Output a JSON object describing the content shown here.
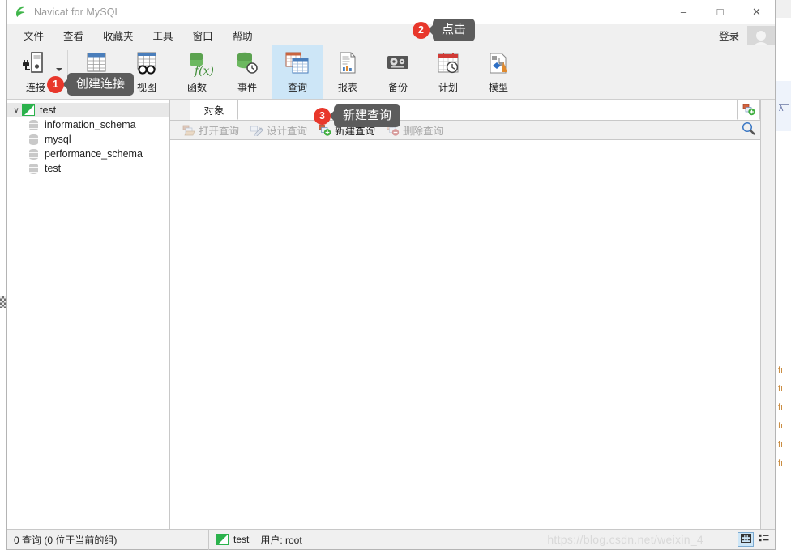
{
  "window": {
    "title": "Navicat for MySQL",
    "logo_icon": "navicat-logo-icon",
    "minimize_label": "–",
    "maximize_label": "□",
    "close_label": "✕"
  },
  "menubar": {
    "items": [
      {
        "label": "文件",
        "name": "menu-file"
      },
      {
        "label": "查看",
        "name": "menu-view"
      },
      {
        "label": "收藏夹",
        "name": "menu-favorites"
      },
      {
        "label": "工具",
        "name": "menu-tools"
      },
      {
        "label": "窗口",
        "name": "menu-window"
      },
      {
        "label": "帮助",
        "name": "menu-help"
      }
    ],
    "login_label": "登录",
    "avatar_icon": "user-avatar-icon"
  },
  "toolbar": {
    "items": [
      {
        "label": "连接",
        "icon": "connection-icon",
        "active": false,
        "has_caret": true
      },
      {
        "label": "表",
        "icon": "table-icon",
        "active": false,
        "has_caret": false
      },
      {
        "label": "视图",
        "icon": "view-icon",
        "active": false,
        "has_caret": false
      },
      {
        "label": "函数",
        "icon": "function-icon",
        "active": false,
        "has_caret": false
      },
      {
        "label": "事件",
        "icon": "event-icon",
        "active": false,
        "has_caret": false
      },
      {
        "label": "查询",
        "icon": "query-icon",
        "active": true,
        "has_caret": false
      },
      {
        "label": "报表",
        "icon": "report-icon",
        "active": false,
        "has_caret": false
      },
      {
        "label": "备份",
        "icon": "backup-icon",
        "active": false,
        "has_caret": false
      },
      {
        "label": "计划",
        "icon": "schedule-icon",
        "active": false,
        "has_caret": false
      },
      {
        "label": "模型",
        "icon": "model-icon",
        "active": false,
        "has_caret": false
      }
    ]
  },
  "sidebar": {
    "root": {
      "label": "test",
      "icon": "connection-node-icon",
      "expanded": true,
      "twisty": "∨"
    },
    "databases": [
      {
        "label": "information_schema",
        "icon": "database-icon"
      },
      {
        "label": "mysql",
        "icon": "database-icon"
      },
      {
        "label": "performance_schema",
        "icon": "database-icon"
      },
      {
        "label": "test",
        "icon": "database-icon"
      }
    ]
  },
  "main": {
    "tab_label": "对象",
    "add_tab_icon": "new-object-tab-icon",
    "actions": [
      {
        "label": "打开查询",
        "icon": "open-query-icon",
        "enabled": false
      },
      {
        "label": "设计查询",
        "icon": "design-query-icon",
        "enabled": false
      },
      {
        "label": "新建查询",
        "icon": "new-query-icon",
        "enabled": true
      },
      {
        "label": "删除查询",
        "icon": "delete-query-icon",
        "enabled": false
      }
    ],
    "search_icon": "search-icon"
  },
  "statusbar": {
    "count_text": "0 查询 (0 位于当前的组)",
    "connection_icon": "connection-node-icon",
    "connection_name": "test",
    "user_text": "用户: root",
    "watermark": "https://blog.csdn.net/weixin_4",
    "view_buttons": [
      {
        "name": "grid-view-button",
        "icon": "grid-view-icon",
        "selected": true
      },
      {
        "name": "list-view-button",
        "icon": "list-view-icon",
        "selected": false
      }
    ]
  },
  "callouts": [
    {
      "number": "1",
      "text": "创建连接",
      "id": "callout-1"
    },
    {
      "number": "2",
      "text": "点击",
      "id": "callout-2"
    },
    {
      "number": "3",
      "text": "新建查询",
      "id": "callout-3"
    }
  ],
  "background": {
    "right_text_lines": [
      "fı",
      "fı",
      "fı",
      "fı",
      "fı",
      "fı"
    ]
  },
  "colors": {
    "accent": "#cde6f7",
    "badge": "#e8372b",
    "bubble": "#5c5c5c",
    "chrome": "#f0f0f0"
  }
}
